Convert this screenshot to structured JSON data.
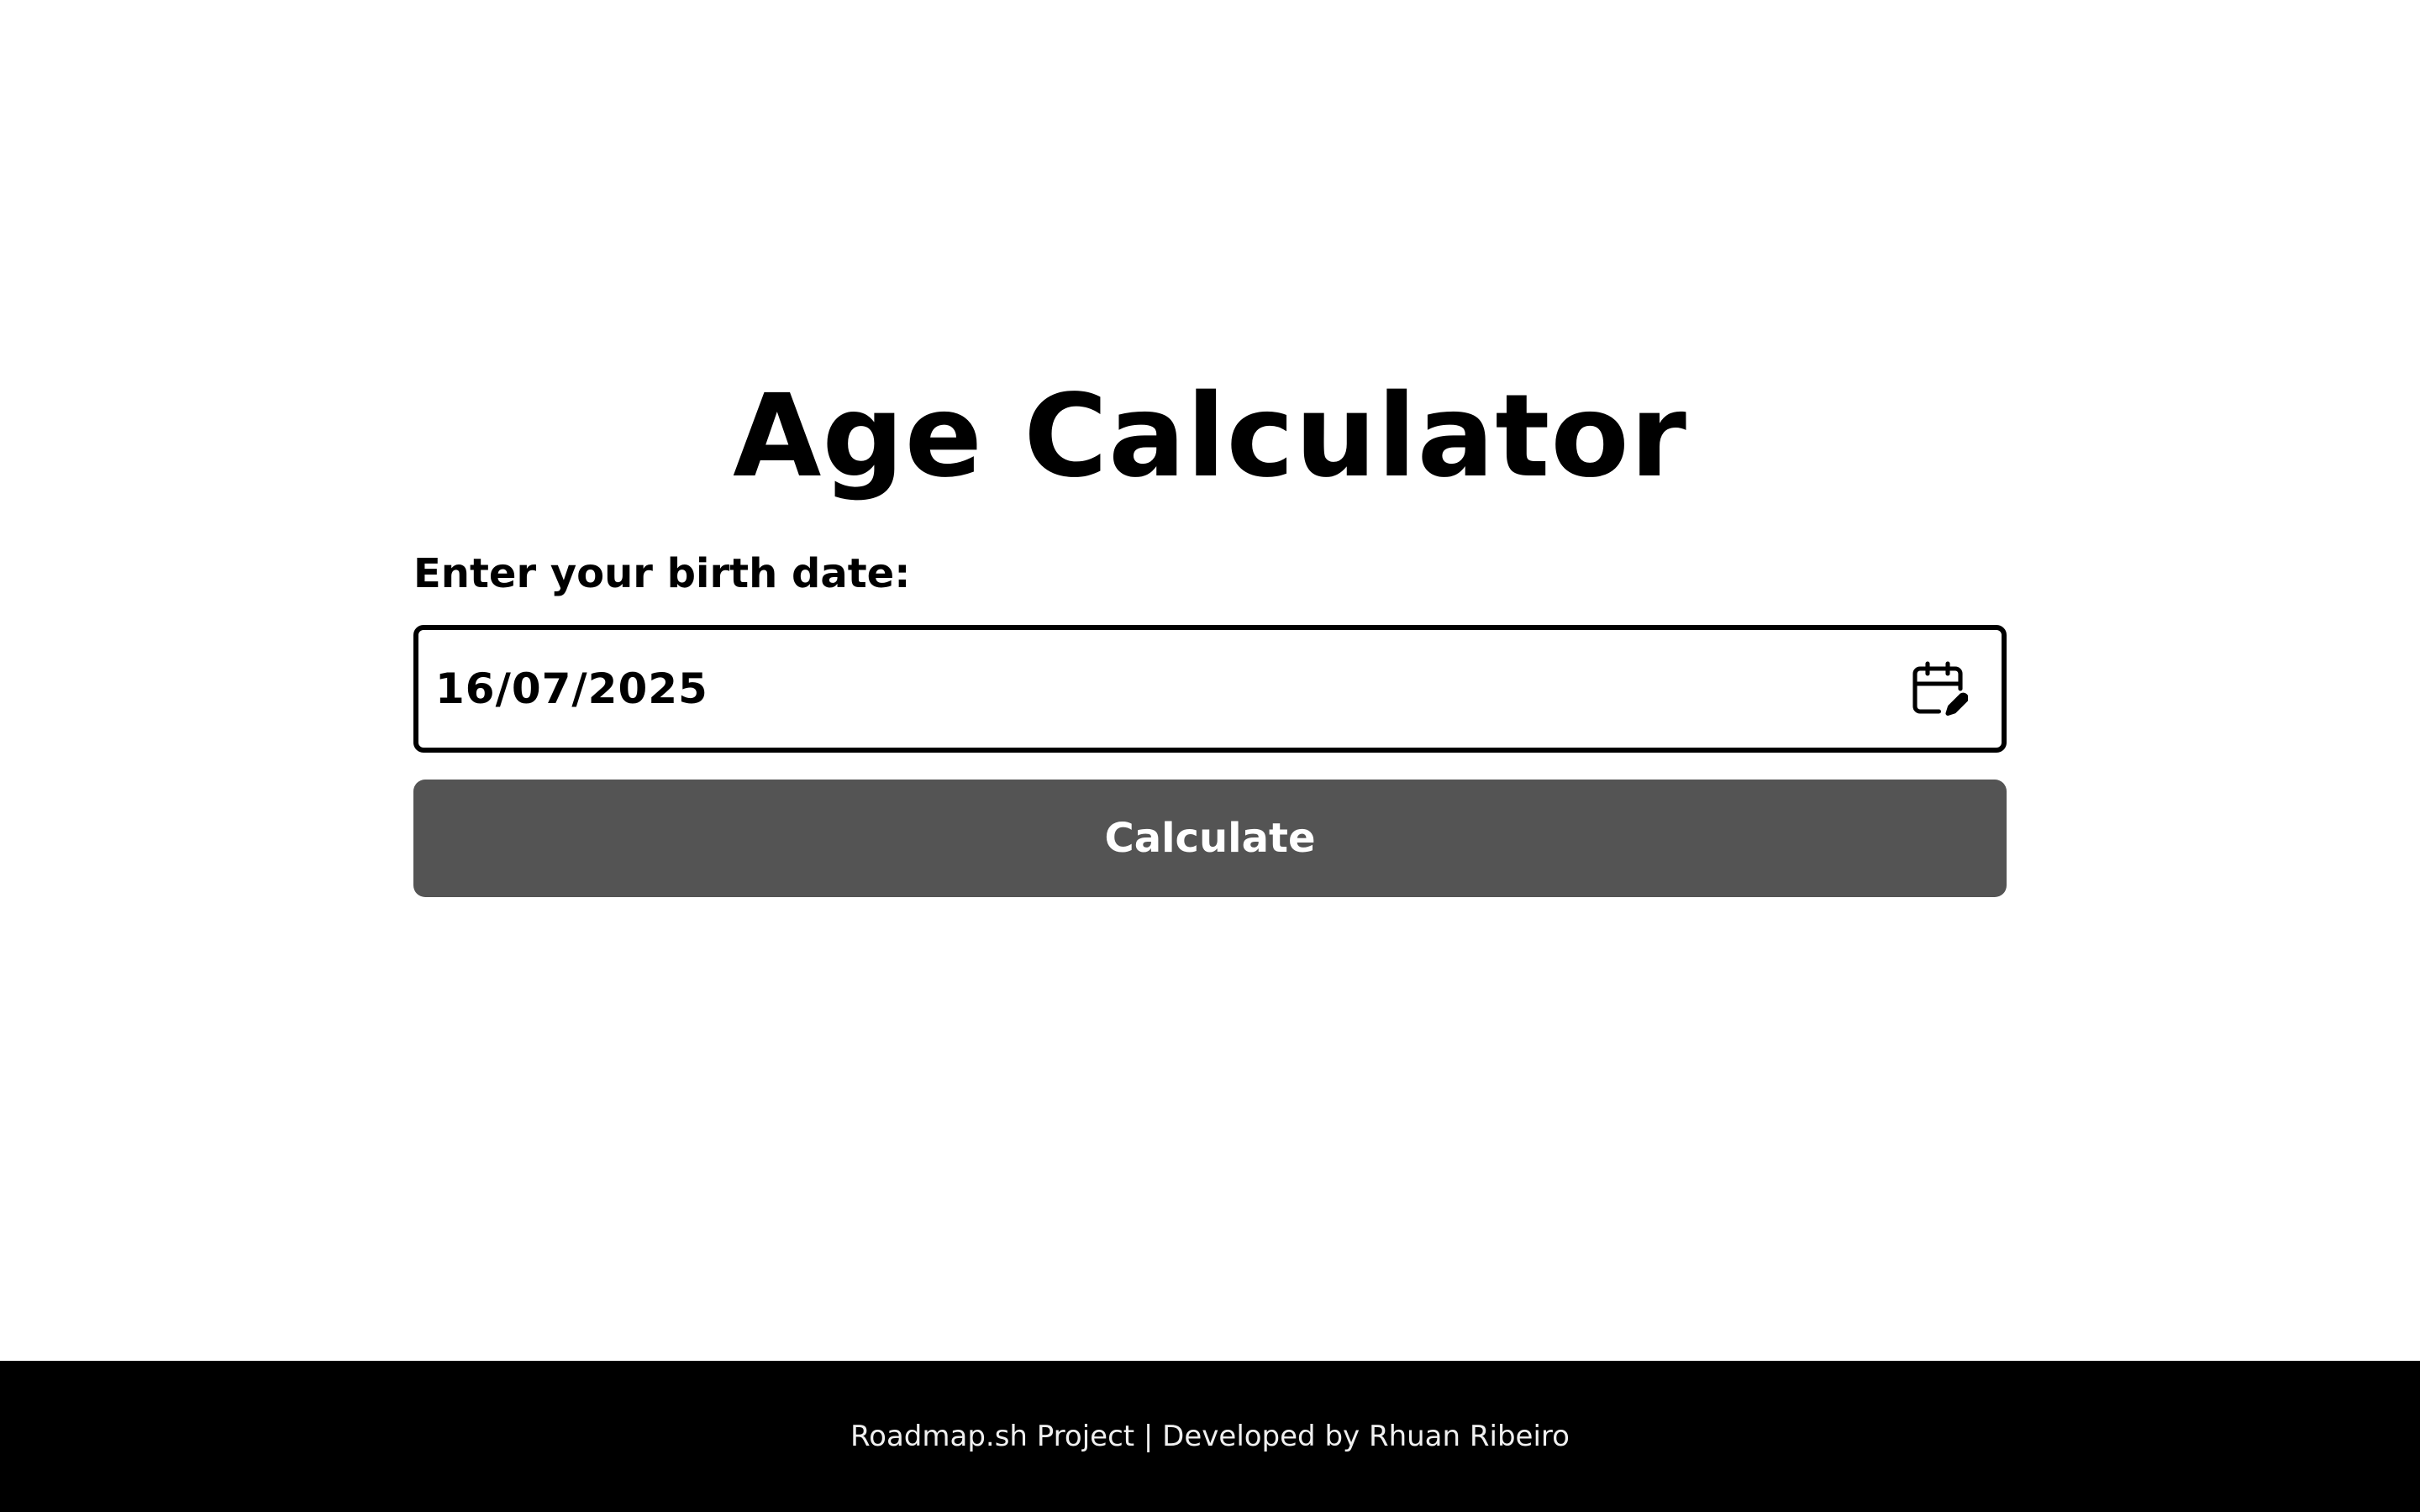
{
  "app": {
    "title": "Age Calculator"
  },
  "form": {
    "label": "Enter your birth date:",
    "date_value": "16/07/2025",
    "calendar_icon": "calendar-edit-icon",
    "button_label": "Calculate"
  },
  "footer": {
    "text": "Roadmap.sh Project | Developed by Rhuan Ribeiro"
  },
  "colors": {
    "background": "#ffffff",
    "text": "#000000",
    "button": "#545454",
    "button_text": "#ffffff",
    "footer_background": "#000000",
    "footer_text": "#f0f0f0"
  }
}
